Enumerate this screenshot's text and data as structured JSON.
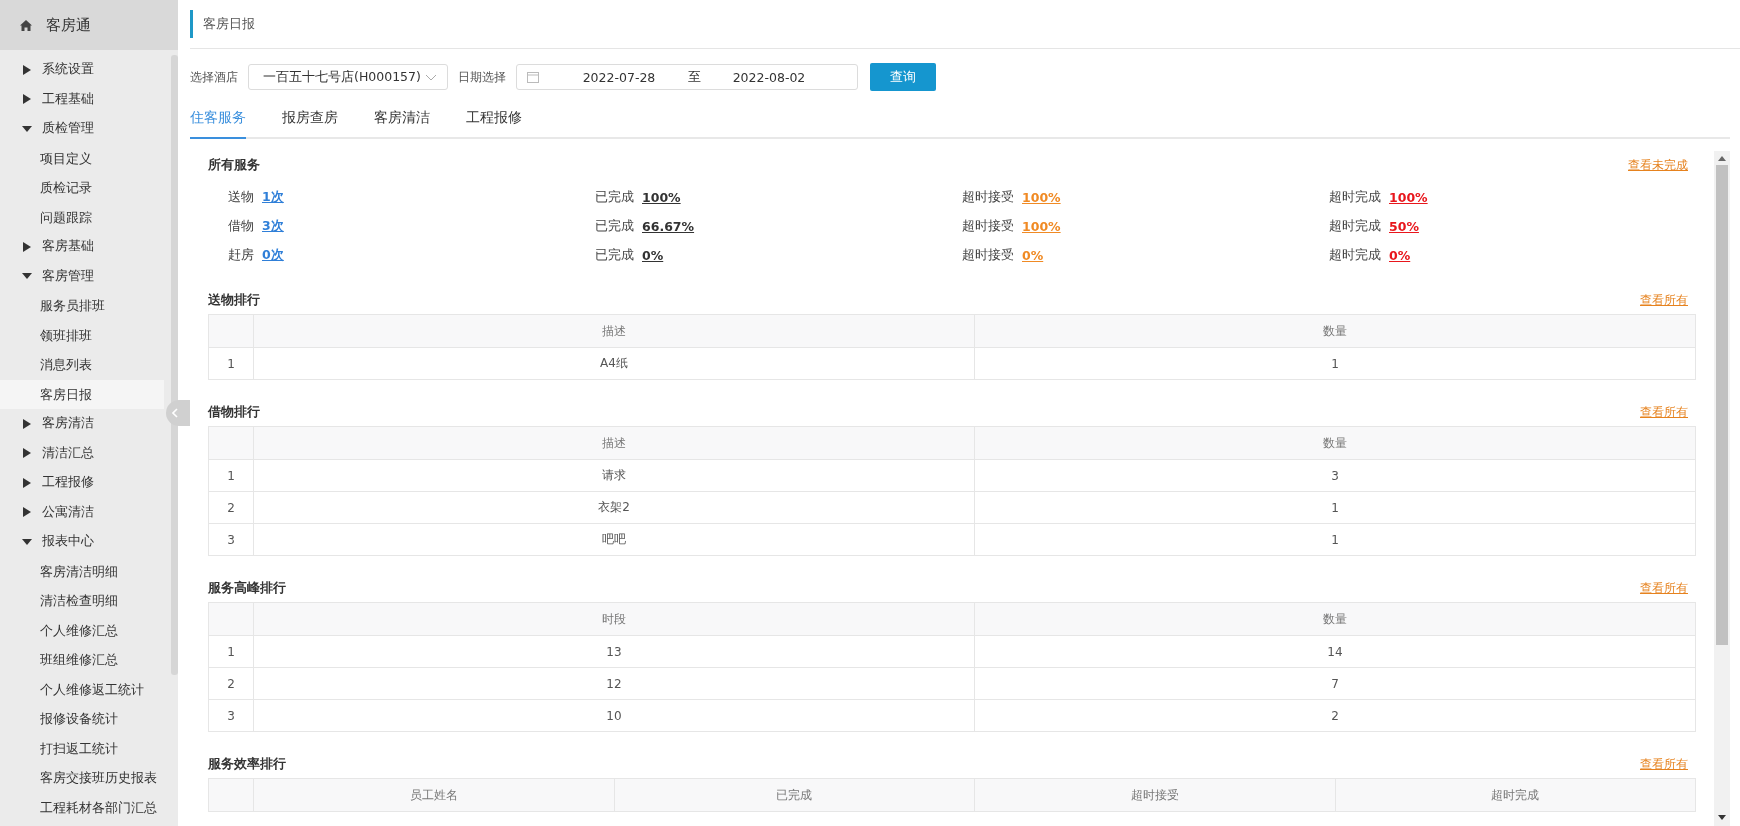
{
  "app": {
    "title": "客房通"
  },
  "sidebar": {
    "items": [
      {
        "label": "系统设置",
        "expanded": false
      },
      {
        "label": "工程基础",
        "expanded": false
      },
      {
        "label": "质检管理",
        "expanded": true,
        "children": [
          {
            "label": "项目定义",
            "selected": false
          },
          {
            "label": "质检记录",
            "selected": false
          },
          {
            "label": "问题跟踪",
            "selected": false
          }
        ]
      },
      {
        "label": "客房基础",
        "expanded": false
      },
      {
        "label": "客房管理",
        "expanded": true,
        "children": [
          {
            "label": "服务员排班",
            "selected": false
          },
          {
            "label": "领班排班",
            "selected": false
          },
          {
            "label": "消息列表",
            "selected": false
          },
          {
            "label": "客房日报",
            "selected": true
          }
        ]
      },
      {
        "label": "客房清洁",
        "expanded": false
      },
      {
        "label": "清洁汇总",
        "expanded": false
      },
      {
        "label": "工程报修",
        "expanded": false
      },
      {
        "label": "公寓清洁",
        "expanded": false
      },
      {
        "label": "报表中心",
        "expanded": true,
        "children": [
          {
            "label": "客房清洁明细",
            "selected": false
          },
          {
            "label": "清洁检查明细",
            "selected": false
          },
          {
            "label": "个人维修汇总",
            "selected": false
          },
          {
            "label": "班组维修汇总",
            "selected": false
          },
          {
            "label": "个人维修返工统计",
            "selected": false
          },
          {
            "label": "报修设备统计",
            "selected": false
          },
          {
            "label": "打扫返工统计",
            "selected": false
          },
          {
            "label": "客房交接班历史报表",
            "selected": false
          },
          {
            "label": "工程耗材各部门汇总",
            "selected": false
          }
        ]
      }
    ]
  },
  "page_title": "客房日报",
  "filters": {
    "hotel_label": "选择酒店",
    "hotel_value": "一百五十七号店(H000157)",
    "date_label": "日期选择",
    "date_from": "2022-07-28",
    "date_sep": "至",
    "date_to": "2022-08-02",
    "query_button": "查询"
  },
  "tabs": [
    {
      "label": "住客服务",
      "selected": true
    },
    {
      "label": "报房查房",
      "selected": false
    },
    {
      "label": "客房清洁",
      "selected": false
    },
    {
      "label": "工程报修",
      "selected": false
    }
  ],
  "summary": {
    "title": "所有服务",
    "link": "查看未完成",
    "rows": [
      {
        "label": "送物",
        "count": "1次",
        "done_label": "已完成",
        "done": "100%",
        "accept_label": "超时接受",
        "accept": "100%",
        "finish_label": "超时完成",
        "finish": "100%"
      },
      {
        "label": "借物",
        "count": "3次",
        "done_label": "已完成",
        "done": "66.67%",
        "accept_label": "超时接受",
        "accept": "100%",
        "finish_label": "超时完成",
        "finish": "50%"
      },
      {
        "label": "赶房",
        "count": "0次",
        "done_label": "已完成",
        "done": "0%",
        "accept_label": "超时接受",
        "accept": "0%",
        "finish_label": "超时完成",
        "finish": "0%"
      }
    ]
  },
  "rankings": [
    {
      "title": "送物排行",
      "link": "查看所有",
      "columns": [
        "",
        "描述",
        "数量"
      ],
      "rows": [
        [
          "1",
          "A4纸",
          "1"
        ]
      ]
    },
    {
      "title": "借物排行",
      "link": "查看所有",
      "columns": [
        "",
        "描述",
        "数量"
      ],
      "rows": [
        [
          "1",
          "请求",
          "3"
        ],
        [
          "2",
          "衣架2",
          "1"
        ],
        [
          "3",
          "吧吧",
          "1"
        ]
      ]
    },
    {
      "title": "服务高峰排行",
      "link": "查看所有",
      "columns": [
        "",
        "时段",
        "数量"
      ],
      "rows": [
        [
          "1",
          "13",
          "14"
        ],
        [
          "2",
          "12",
          "7"
        ],
        [
          "3",
          "10",
          "2"
        ]
      ]
    },
    {
      "title": "服务效率排行",
      "link": "查看所有",
      "columns": [
        "",
        "员工姓名",
        "已完成",
        "超时接受",
        "超时完成"
      ]
    }
  ]
}
